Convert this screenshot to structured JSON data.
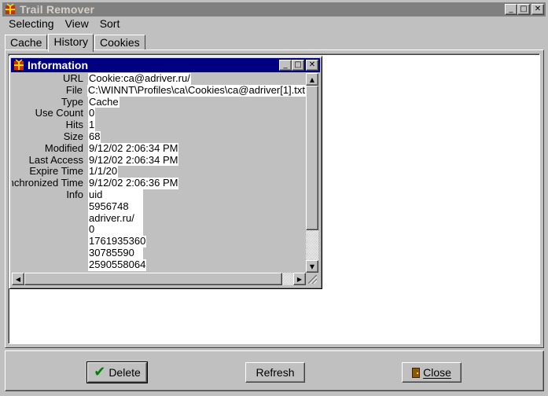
{
  "window": {
    "title": "Trail Remover",
    "minimize": "_",
    "maximize": "□",
    "close": "✕"
  },
  "menu": [
    "Selecting",
    "View",
    "Sort"
  ],
  "tabs": [
    {
      "label": "Cache",
      "active": false
    },
    {
      "label": "History",
      "active": true
    },
    {
      "label": "Cookies",
      "active": false
    }
  ],
  "info_window": {
    "title": "Information",
    "minimize": "_",
    "maximize": "□",
    "close": "✕",
    "fields": [
      {
        "label": "URL",
        "value": "Cookie:ca@adriver.ru/"
      },
      {
        "label": "File",
        "value": "C:\\WINNT\\Profiles\\ca\\Cookies\\ca@adriver[1].txt"
      },
      {
        "label": "Type",
        "value": "Cache"
      },
      {
        "label": "Use Count",
        "value": "0"
      },
      {
        "label": "Hits",
        "value": "1"
      },
      {
        "label": "Size",
        "value": "68"
      },
      {
        "label": "Modified",
        "value": "9/12/02 2:06:34 PM"
      },
      {
        "label": "Last Access",
        "value": "9/12/02 2:06:34 PM"
      },
      {
        "label": "Expire Time",
        "value": "1/1/20"
      },
      {
        "label": "Synchronized Time",
        "value": "9/12/02 2:06:36 PM"
      },
      {
        "label": "Info",
        "value": "uid"
      }
    ],
    "info_lines": [
      "5956748",
      "adriver.ru/",
      "0",
      "1761935360",
      "30785590",
      "2590558064"
    ]
  },
  "buttons": {
    "delete": "Delete",
    "refresh": "Refresh",
    "close": "Close"
  },
  "colors": {
    "face": "#c0c0c0",
    "active_title": "#000080",
    "inactive_title": "#808080"
  }
}
